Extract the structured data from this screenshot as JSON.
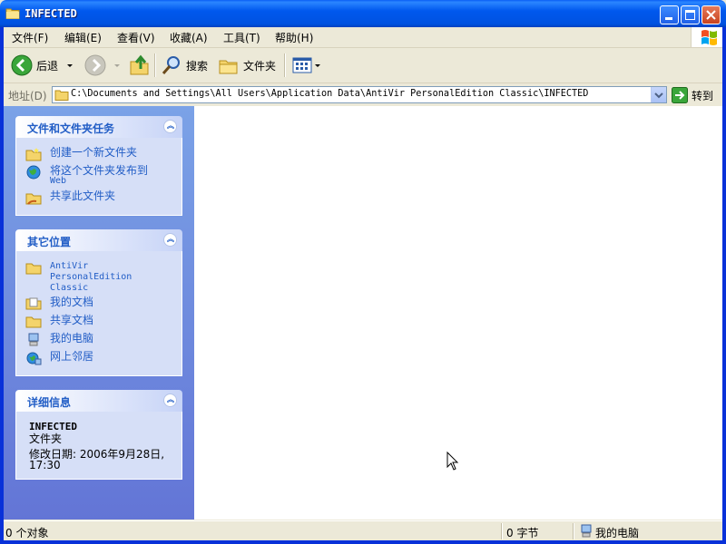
{
  "window": {
    "title": "INFECTED",
    "controls": [
      "minimize",
      "maximize",
      "close"
    ]
  },
  "menubar": {
    "items": [
      "文件(F)",
      "编辑(E)",
      "查看(V)",
      "收藏(A)",
      "工具(T)",
      "帮助(H)"
    ]
  },
  "toolbar": {
    "back_label": "后退",
    "search_label": "搜索",
    "folders_label": "文件夹"
  },
  "addressbar": {
    "label": "地址(D)",
    "path": "C:\\Documents and Settings\\All Users\\Application Data\\AntiVir PersonalEdition Classic\\INFECTED",
    "go_label": "转到"
  },
  "leftpane": {
    "tasks": {
      "title": "文件和文件夹任务",
      "items": [
        "创建一个新文件夹",
        "将这个文件夹发布到",
        "Web",
        "共享此文件夹"
      ]
    },
    "places": {
      "title": "其它位置",
      "items": [
        "AntiVir",
        "PersonalEdition",
        "Classic",
        "我的文档",
        "共享文档",
        "我的电脑",
        "网上邻居"
      ]
    },
    "details": {
      "title": "详细信息",
      "name": "INFECTED",
      "type": "文件夹",
      "modified": "修改日期: 2006年9月28日,",
      "modified_time": "17:30"
    }
  },
  "statusbar": {
    "objects": "0 个对象",
    "size": "0 字节",
    "location": "我的电脑"
  },
  "colors": {
    "titlebar": "#0058ee",
    "link": "#215dc6",
    "leftpane_top": "#7ba2e7",
    "leftpane_bottom": "#6375d6"
  }
}
